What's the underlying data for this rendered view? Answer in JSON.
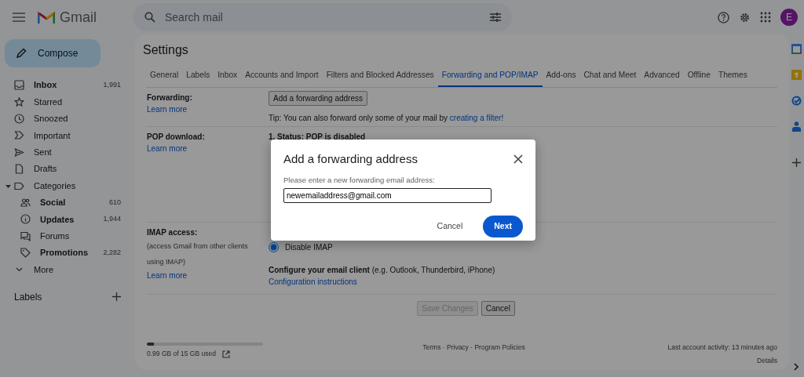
{
  "header": {
    "logo_text": "Gmail",
    "search": {
      "placeholder": "Search mail"
    },
    "avatar": "E"
  },
  "compose": "Compose",
  "nav": [
    {
      "label": "Inbox",
      "count": "1,991",
      "bold": true
    },
    {
      "label": "Starred",
      "bold": false
    },
    {
      "label": "Snoozed",
      "bold": false
    },
    {
      "label": "Important",
      "bold": false
    },
    {
      "label": "Sent",
      "bold": false
    },
    {
      "label": "Drafts",
      "bold": false
    },
    {
      "label": "Categories",
      "bold": false,
      "expanded": true,
      "children": [
        {
          "label": "Social",
          "count": "610",
          "bold": true
        },
        {
          "label": "Updates",
          "count": "1,944",
          "bold": true
        },
        {
          "label": "Forums",
          "bold": false
        },
        {
          "label": "Promotions",
          "count": "2,282",
          "bold": true
        }
      ]
    },
    {
      "label": "More",
      "bold": false
    }
  ],
  "labels_heading": "Labels",
  "settings": {
    "title": "Settings",
    "tabs": [
      {
        "label": "General",
        "selected": false
      },
      {
        "label": "Labels",
        "selected": false
      },
      {
        "label": "Inbox",
        "selected": false
      },
      {
        "label": "Accounts and Import",
        "selected": false
      },
      {
        "label": "Filters and Blocked Addresses",
        "selected": false
      },
      {
        "label": "Forwarding and POP/IMAP",
        "selected": true
      },
      {
        "label": "Add-ons",
        "selected": false
      },
      {
        "label": "Chat and Meet",
        "selected": false
      },
      {
        "label": "Advanced",
        "selected": false
      },
      {
        "label": "Offline",
        "selected": false
      },
      {
        "label": "Themes",
        "selected": false
      }
    ],
    "forwarding": {
      "label": "Forwarding:",
      "learn_more": "Learn more",
      "button": "Add a forwarding address",
      "tip": "Tip: You can also forward only some of your mail by",
      "tip_link": "creating a filter!"
    },
    "pop": {
      "label": "POP download:",
      "learn_more": "Learn more",
      "status": "1. Status: POP is disabled"
    },
    "imap": {
      "label": "IMAP access:",
      "note": "(access Gmail from other clients using IMAP)",
      "learn_more": "Learn more",
      "options": [
        {
          "label": "Disable IMAP",
          "selected": true
        }
      ],
      "configure": "**Configure your email client** (e.g. Outlook, Thunderbird, iPhone)",
      "configure_link": "Configuration instructions"
    },
    "actions": [
      {
        "label": "Save Changes",
        "disabled": true
      },
      {
        "label": "Cancel",
        "disabled": false
      }
    ]
  },
  "footer": {
    "storage": {
      "level": 0.06,
      "text": "0.99 GB of 15 GB used"
    },
    "links": "Terms · Privacy · Program Policies",
    "activity": "Last account activity: 13 minutes ago",
    "details": "Details"
  },
  "dialog": {
    "title": "Add a forwarding address",
    "prompt": "Please enter a new forwarding email address:",
    "value": "newemailaddress@gmail.com",
    "cancel": "Cancel",
    "next": "Next"
  }
}
